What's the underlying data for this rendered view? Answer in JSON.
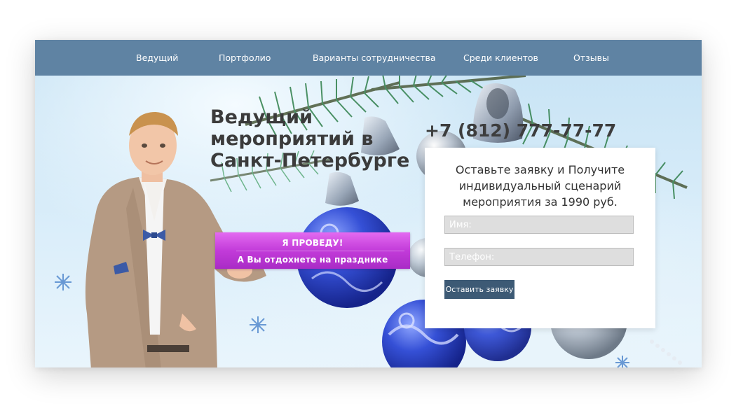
{
  "nav": {
    "items": [
      {
        "label": "Ведущий"
      },
      {
        "label": "Портфолио"
      },
      {
        "label": "Варианты сотрудничества"
      },
      {
        "label": "Среди клиентов"
      },
      {
        "label": "Отзывы"
      }
    ]
  },
  "hero": {
    "title": "Ведущий мероприятий в Санкт-Петербурге",
    "phone": "+7 (812) 777-77-77",
    "ribbon": {
      "line1": "Я ПРОВЕДУ!",
      "line2": "А Вы отдохнете на празднике"
    }
  },
  "form": {
    "title": "Оставьте заявку и Получите индивидуальный сценарий мероприятия за 1990 руб.",
    "name_placeholder": "Имя:",
    "phone_placeholder": "Телефон:",
    "submit_label": "Оставить заявку"
  },
  "colors": {
    "nav_bg": "#5f83a3",
    "ribbon": "#c23bd9",
    "button": "#3d5a75",
    "ornament_blue": "#2f49c9"
  }
}
